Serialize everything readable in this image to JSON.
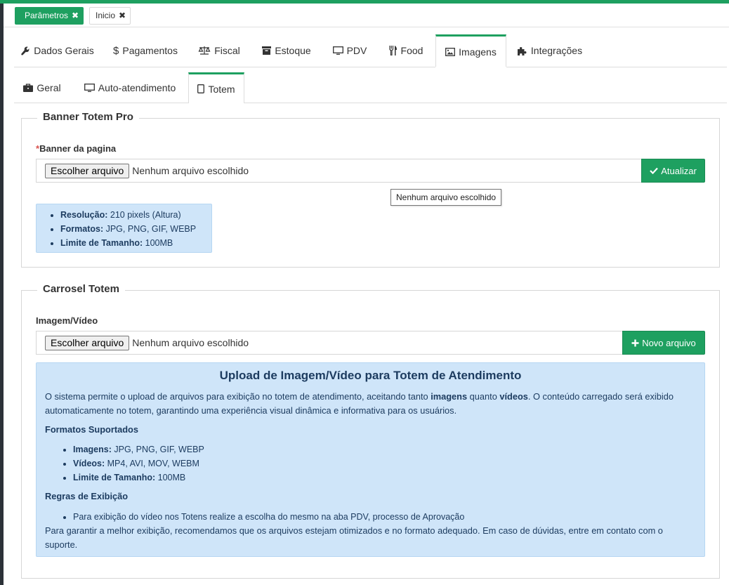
{
  "doc_tabs": [
    {
      "label": "Parâmetros",
      "active": true
    },
    {
      "label": "Inicio",
      "active": false
    }
  ],
  "main_tabs": [
    {
      "label": "Dados Gerais",
      "icon": "wrench-icon"
    },
    {
      "label": "Pagamentos",
      "icon": "dollar-icon"
    },
    {
      "label": "Fiscal",
      "icon": "balance-scale-icon"
    },
    {
      "label": "Estoque",
      "icon": "archive-icon"
    },
    {
      "label": "PDV",
      "icon": "monitor-icon"
    },
    {
      "label": "Food",
      "icon": "cutlery-icon"
    },
    {
      "label": "Imagens",
      "icon": "image-icon",
      "active": true
    },
    {
      "label": "Integrações",
      "icon": "puzzle-icon"
    }
  ],
  "sub_tabs": [
    {
      "label": "Geral",
      "icon": "briefcase-icon"
    },
    {
      "label": "Auto-atendimento",
      "icon": "monitor-icon"
    },
    {
      "label": "Totem",
      "icon": "tablet-icon",
      "active": true
    }
  ],
  "banner": {
    "legend": "Banner Totem Pro",
    "required_mark": "*",
    "label": "Banner da pagina",
    "file_button": "Escolher arquivo",
    "file_status": "Nenhum arquivo escolhido",
    "submit_label": "Atualizar",
    "tooltip": "Nenhum arquivo escolhido",
    "specs": [
      {
        "key": "Resolução:",
        "value": " 210 pixels (Altura)"
      },
      {
        "key": "Formatos:",
        "value": " JPG, PNG, GIF, WEBP"
      },
      {
        "key": "Limite de Tamanho:",
        "value": " 100MB"
      }
    ]
  },
  "carousel": {
    "legend": "Carrosel Totem",
    "label": "Imagem/Vídeo",
    "file_button": "Escolher arquivo",
    "file_status": "Nenhum arquivo escolhido",
    "submit_label": "Novo arquivo",
    "info": {
      "title": "Upload de Imagem/Vídeo para Totem de Atendimento",
      "intro_a": "O sistema permite o upload de arquivos para exibição no totem de atendimento, aceitando tanto ",
      "intro_b": "imagens",
      "intro_c": " quanto ",
      "intro_d": "vídeos",
      "intro_e": ". O conteúdo carregado será exibido",
      "intro_line2": "automaticamente no totem, garantindo uma experiência visual dinâmica e informativa para os usuários.",
      "formats_heading": "Formatos Suportados",
      "formats": [
        {
          "key": "Imagens:",
          "value": " JPG, PNG, GIF, WEBP"
        },
        {
          "key": "Vídeos:",
          "value": " MP4, AVI, MOV, WEBM"
        },
        {
          "key": "Limite de Tamanho:",
          "value": " 100MB"
        }
      ],
      "rules_heading": "Regras de Exibição",
      "rules": [
        "Para exibição do vídeo nos Totens realize a escolha do mesmo na aba PDV, processo de Aprovação"
      ],
      "footer_line1": "Para garantir a melhor exibição, recomendamos que os arquivos estejam otimizados e no formato adequado. Em caso de dúvidas, entre em contato com o",
      "footer_line2": "suporte."
    }
  },
  "colors": {
    "accent": "#1ea060",
    "info_bg": "#cfe5f9",
    "info_text": "#1d3c60"
  }
}
